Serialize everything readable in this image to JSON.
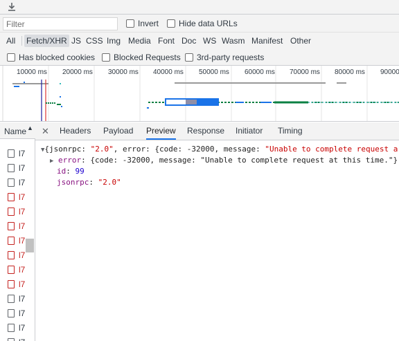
{
  "toolbar": {
    "download_icon": "download-icon"
  },
  "filter": {
    "placeholder": "Filter",
    "invert_label": "Invert",
    "hide_data_urls_label": "Hide data URLs"
  },
  "types": [
    "All",
    "Fetch/XHR",
    "JS",
    "CSS",
    "Img",
    "Media",
    "Font",
    "Doc",
    "WS",
    "Wasm",
    "Manifest",
    "Other"
  ],
  "active_type": "Fetch/XHR",
  "blocked": {
    "has_blocked_cookies": "Has blocked cookies",
    "blocked_requests": "Blocked Requests",
    "third_party": "3rd-party requests"
  },
  "overview": {
    "ticks": [
      "10000 ms",
      "20000 ms",
      "30000 ms",
      "40000 ms",
      "50000 ms",
      "60000 ms",
      "70000 ms",
      "80000 ms",
      "90000"
    ]
  },
  "name_column": {
    "header": "Name",
    "rows": [
      {
        "text": "l7",
        "error": false
      },
      {
        "text": "l7",
        "error": false
      },
      {
        "text": "l7",
        "error": false
      },
      {
        "text": "l7",
        "error": true
      },
      {
        "text": "l7",
        "error": true
      },
      {
        "text": "l7",
        "error": true
      },
      {
        "text": "l7",
        "error": true
      },
      {
        "text": "l7",
        "error": true
      },
      {
        "text": "l7",
        "error": true
      },
      {
        "text": "l7",
        "error": true
      },
      {
        "text": "l7",
        "error": false
      },
      {
        "text": "l7",
        "error": false
      },
      {
        "text": "l7",
        "error": false
      },
      {
        "text": "l7",
        "error": false
      }
    ]
  },
  "detail_tabs": [
    "Headers",
    "Payload",
    "Preview",
    "Response",
    "Initiator",
    "Timing"
  ],
  "active_tab": "Preview",
  "preview": {
    "summary_open": "{jsonrpc: ",
    "summary_jsonrpc": "\"2.0\"",
    "summary_mid": ", error: {code: -32000, message: ",
    "summary_message": "\"Unable to complete request a",
    "error_key": "error",
    "error_preview": ": {code: -32000, message: \"Unable to complete request at this time.\"}",
    "id_key": "id",
    "id_value": "99",
    "jsonrpc_key": "jsonrpc",
    "jsonrpc_value": "\"2.0\""
  },
  "colors": {
    "accent": "#1a73e8",
    "error": "#c5221f"
  }
}
